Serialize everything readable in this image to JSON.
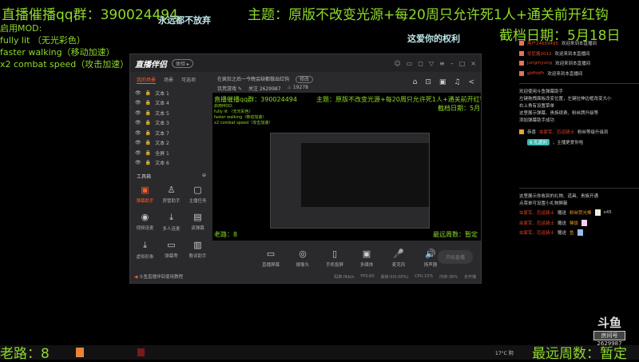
{
  "overlay": {
    "qq": "直播催播qq群：390024494",
    "slogan1": "永远都不放弃",
    "theme": "主题：原版不改变光源+每20周只允许死1人+通关前开红钩",
    "slogan2": "这爱你的权利",
    "deadline": "截档日期：5月18日",
    "mods_title": "启用MOD:",
    "mods": [
      "fully lit （无光彩色）",
      "faster walking（移动加速）",
      "x2 combat speed（攻击加速）"
    ],
    "old_road": "老路：8",
    "recent_weeks": "最远周数：暂定",
    "accent": "#8fd92a"
  },
  "app": {
    "logo": "直播伴侣",
    "badge": "体验 ▸",
    "window_controls": [
      "☺",
      "▭",
      "◻",
      "▽",
      "≡",
      "–",
      "□",
      "×"
    ],
    "tabs": [
      "我的场景",
      "场景",
      "可选项"
    ],
    "layers": [
      "文本 1",
      "文本 4",
      "文本 5",
      "文本 3",
      "文本 7",
      "文本 2",
      "全屏 1",
      "文本 6"
    ],
    "toolbox_title": "工具箱",
    "tools": [
      {
        "label": "弹幕助手",
        "icon": "▣"
      },
      {
        "label": "房管助手",
        "icon": "♙"
      },
      {
        "label": "主播任务",
        "icon": "▢"
      },
      {
        "label": "视频连麦",
        "icon": "◉"
      },
      {
        "label": "多人连麦",
        "icon": "⤓"
      },
      {
        "label": "读弹幕",
        "icon": "▤"
      },
      {
        "label": "虚拟形象",
        "icon": "⤓"
      },
      {
        "label": "弹幕秀",
        "icon": "▭"
      },
      {
        "label": "歌词助手",
        "icon": "▥"
      }
    ],
    "footer": "斗鱼直播伴侣使用教程",
    "stream_title": "在疯狂之后一今晚会缺都做出红钩",
    "stream_tag": "修改",
    "category": "饥荒游戏 ✎",
    "followers": "关注 2629987",
    "heat": "♨ 19278",
    "head_icons": [
      "⌂",
      "⊡",
      "▣",
      "♫",
      "<"
    ],
    "bottom_tools": [
      {
        "label": "直播屏幕",
        "icon": "▭"
      },
      {
        "label": "摄像头",
        "icon": "◎"
      },
      {
        "label": "手机投屏",
        "icon": "▯"
      },
      {
        "label": "多媒体",
        "icon": "▣"
      },
      {
        "label": "麦克风",
        "icon": "🎤"
      },
      {
        "label": "扬声器",
        "icon": "🔊"
      }
    ],
    "start_label": "开始直播",
    "stats": [
      "码率:0kb/s",
      "FPS:60",
      "丢帧:0(0.00%)",
      "CPU:15%",
      "内存:36%",
      "长开播"
    ]
  },
  "chat": {
    "welcome": [
      {
        "user": "用户24659495",
        "text": "欢迎来到本直播间"
      },
      {
        "user": "优尼酱2012",
        "text": "欢迎来到本直播间"
      },
      {
        "user": "jungmyung",
        "text": "欢迎来到本直播间"
      },
      {
        "user": "gbfhbfh",
        "text": "欢迎来到本直播间"
      }
    ],
    "info": [
      "欢迎使用斗鱼弹幕助手",
      "左键拖拽面板改变位置，左键拉伸边框改变大小",
      "右上角有设置菜单",
      "这里展示弹幕、贵族续费、粉丝牌升级等",
      "添加弹幕助手成功"
    ],
    "levelup": {
      "prefix": "恭喜",
      "user": "虫家军、厄运骑士",
      "text": "粉丝等级升级到",
      "badge": "6 孔渡刘",
      "suffix": "，主播更爱你啦"
    },
    "gift_info": [
      "这里展示你收到的礼物、道具、贵族开通",
      "点菜单可设置小礼物屏蔽"
    ],
    "gifts": [
      {
        "user": "虫家军、厄运骑士",
        "verb": "赠送",
        "item": "粉丝荧光棒",
        "count": "x45"
      },
      {
        "user": "虫家军、厄运骑士",
        "verb": "赠送",
        "item": "稀饭",
        "count": ""
      },
      {
        "user": "虫家军、厄运骑士",
        "verb": "赠送",
        "item": "鱼",
        "count": ""
      }
    ]
  },
  "brand": {
    "logo": "斗鱼",
    "room_label": "房间号",
    "room_id": "2629987"
  },
  "taskbar": {
    "weather": "17°C 阴"
  }
}
